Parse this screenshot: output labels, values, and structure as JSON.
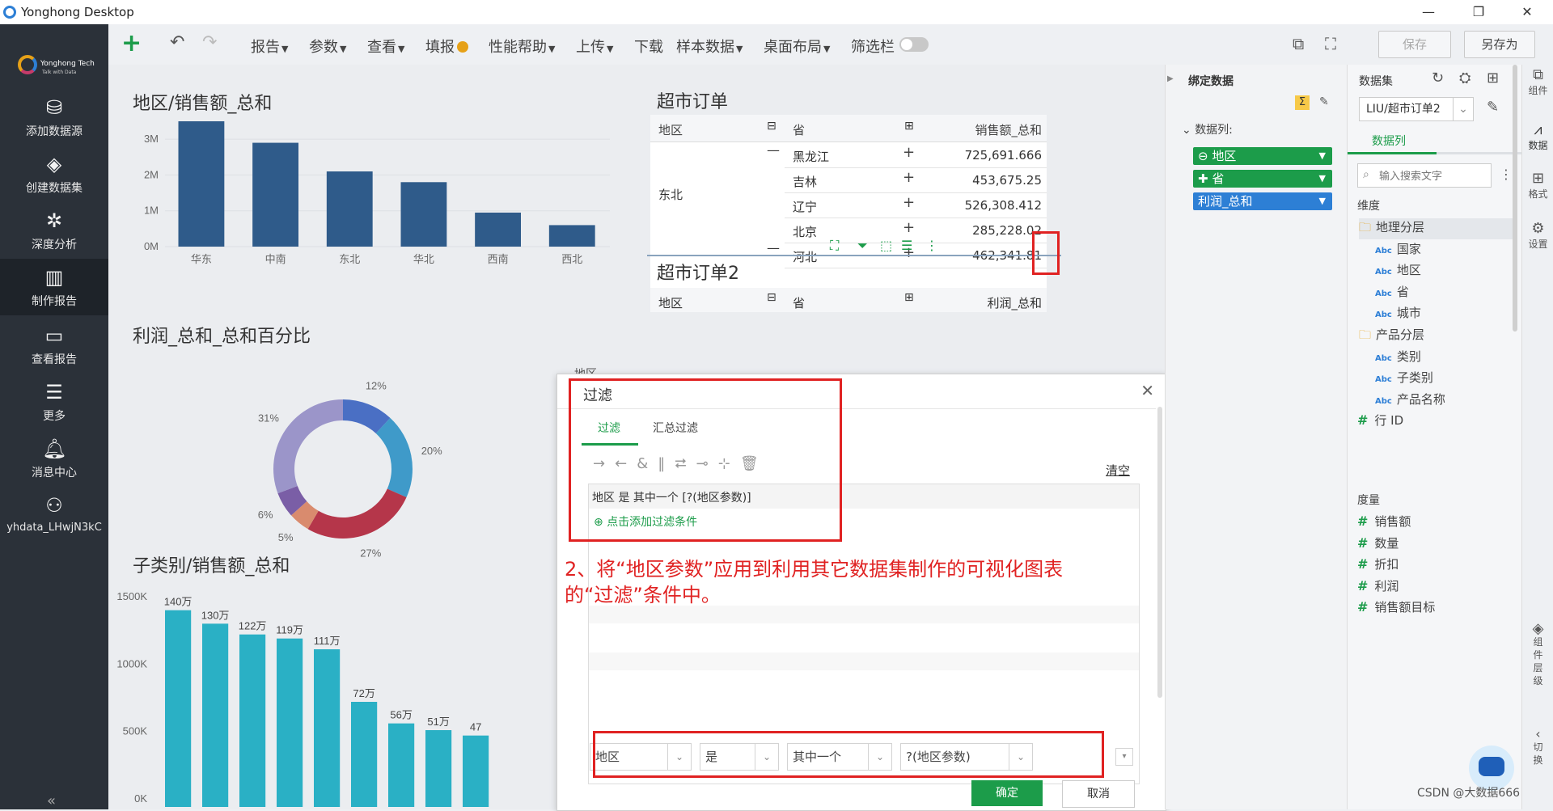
{
  "window": {
    "title": "Yonghong Desktop",
    "controls": [
      "—",
      "❐",
      "✕"
    ]
  },
  "logo": {
    "brand": "Yonghong Tech",
    "tagline": "Talk with Data"
  },
  "nav": {
    "items": [
      {
        "label": "添加数据源",
        "icon": "database-icon"
      },
      {
        "label": "创建数据集",
        "icon": "layers-icon"
      },
      {
        "label": "深度分析",
        "icon": "network-icon"
      },
      {
        "label": "制作报告",
        "icon": "report-chart-icon"
      },
      {
        "label": "查看报告",
        "icon": "monitor-chart-icon"
      },
      {
        "label": "更多",
        "icon": "menu-icon"
      },
      {
        "label": "消息中心",
        "icon": "bell-icon"
      },
      {
        "label": "yhdata_LHwjN3kC",
        "icon": "user-icon"
      }
    ],
    "collapse": "«"
  },
  "toolbar": {
    "menus": [
      "报告",
      "参数",
      "查看",
      "填报",
      "性能帮助",
      "上传",
      "下载",
      "样本数据",
      "桌面布局",
      "筛选栏"
    ],
    "save": "保存",
    "save_as": "另存为"
  },
  "charts": {
    "bar1_title": "地区/销售额_总和",
    "donut_title": "利润_总和_总和百分比",
    "donut_legend": "地区",
    "bar2_title": "子类别/销售额_总和"
  },
  "chart_data": [
    {
      "type": "bar",
      "title": "地区/销售额_总和",
      "categories": [
        "华东",
        "中南",
        "东北",
        "华北",
        "西南",
        "西北"
      ],
      "values": [
        3.5,
        2.9,
        2.1,
        1.8,
        0.95,
        0.6
      ],
      "yticks": [
        "3M",
        "2M",
        "1M",
        "0M"
      ],
      "ylim": [
        0,
        3.5
      ],
      "color": "#2f5b8a"
    },
    {
      "type": "pie",
      "title": "利润_总和_总和百分比",
      "labels": [
        "12%",
        "20%",
        "27%",
        "5%",
        "6%",
        "31%"
      ],
      "values": [
        12,
        20,
        27,
        5,
        6,
        31
      ],
      "colors": [
        "#4a6fc4",
        "#3f9ac9",
        "#b5364a",
        "#d98b6e",
        "#7a5ea6",
        "#9b95c9"
      ]
    },
    {
      "type": "bar",
      "title": "子类别/销售额_总和",
      "categories": [
        "",
        "",
        "",
        "",
        "",
        "",
        "",
        "",
        "",
        ""
      ],
      "values": [
        140,
        130,
        122,
        119,
        111,
        72,
        56,
        51,
        47,
        0
      ],
      "data_labels": [
        "140万",
        "130万",
        "122万",
        "119万",
        "111万",
        "72万",
        "56万",
        "51万",
        "47",
        ""
      ],
      "yticks": [
        "1500K",
        "1000K",
        "500K",
        "0K"
      ],
      "ylim": [
        0,
        150
      ],
      "color": "#2ab0c5"
    }
  ],
  "table1": {
    "title": "超市订单",
    "headers": [
      "地区",
      "省",
      "销售额_总和"
    ],
    "region": "东北",
    "rows": [
      {
        "province": "黑龙江",
        "value": "725,691.666"
      },
      {
        "province": "吉林",
        "value": "453,675.25"
      },
      {
        "province": "辽宁",
        "value": "526,308.412"
      },
      {
        "province": "北京",
        "value": "285,228.02"
      },
      {
        "province": "河北",
        "value": "462,341.81"
      }
    ]
  },
  "table2": {
    "title": "超市订单2",
    "headers": [
      "地区",
      "省",
      "利润_总和"
    ]
  },
  "dialog": {
    "title": "过滤",
    "tabs": [
      "过滤",
      "汇总过滤"
    ],
    "clear": "清空",
    "condition": "地区 是 其中一个 [?(地区参数)]",
    "add_condition": "点击添加过滤条件",
    "editor": {
      "field": "地区",
      "op": "是",
      "mode": "其中一个",
      "value": "?(地区参数)"
    },
    "ok": "确定",
    "cancel": "取消"
  },
  "annotation": {
    "line1": "2、将“地区参数”应用到利用其它数据集制作的可视化图表",
    "line2": "的“过滤”条件中。"
  },
  "bind": {
    "title": "绑定数据",
    "section": "数据列:",
    "pills": [
      {
        "label": "地区",
        "color": "#1c9c4a"
      },
      {
        "label": "省",
        "color": "#1c9c4a"
      },
      {
        "label": "利润_总和",
        "color": "#2d7fd5"
      }
    ]
  },
  "dataset": {
    "title": "数据集",
    "selected": "LIU/超市订单2",
    "tab": "数据列",
    "search_placeholder": "输入搜索文字",
    "dimensions_label": "维度",
    "dimensions": [
      {
        "label": "地理分层",
        "kind": "folder"
      },
      {
        "label": "国家",
        "kind": "abc"
      },
      {
        "label": "地区",
        "kind": "abc"
      },
      {
        "label": "省",
        "kind": "abc"
      },
      {
        "label": "城市",
        "kind": "abc"
      },
      {
        "label": "产品分层",
        "kind": "folder"
      },
      {
        "label": "类别",
        "kind": "abc"
      },
      {
        "label": "子类别",
        "kind": "abc"
      },
      {
        "label": "产品名称",
        "kind": "abc"
      },
      {
        "label": "行 ID",
        "kind": "num"
      }
    ],
    "measures_label": "度量",
    "measures": [
      "销售额",
      "数量",
      "折扣",
      "利润",
      "销售额目标"
    ]
  },
  "rightbar": {
    "items": [
      "组件",
      "数据",
      "格式",
      "设置"
    ],
    "layers": "组件层级",
    "switch": "切换"
  },
  "watermark": "CSDN @大数据666"
}
